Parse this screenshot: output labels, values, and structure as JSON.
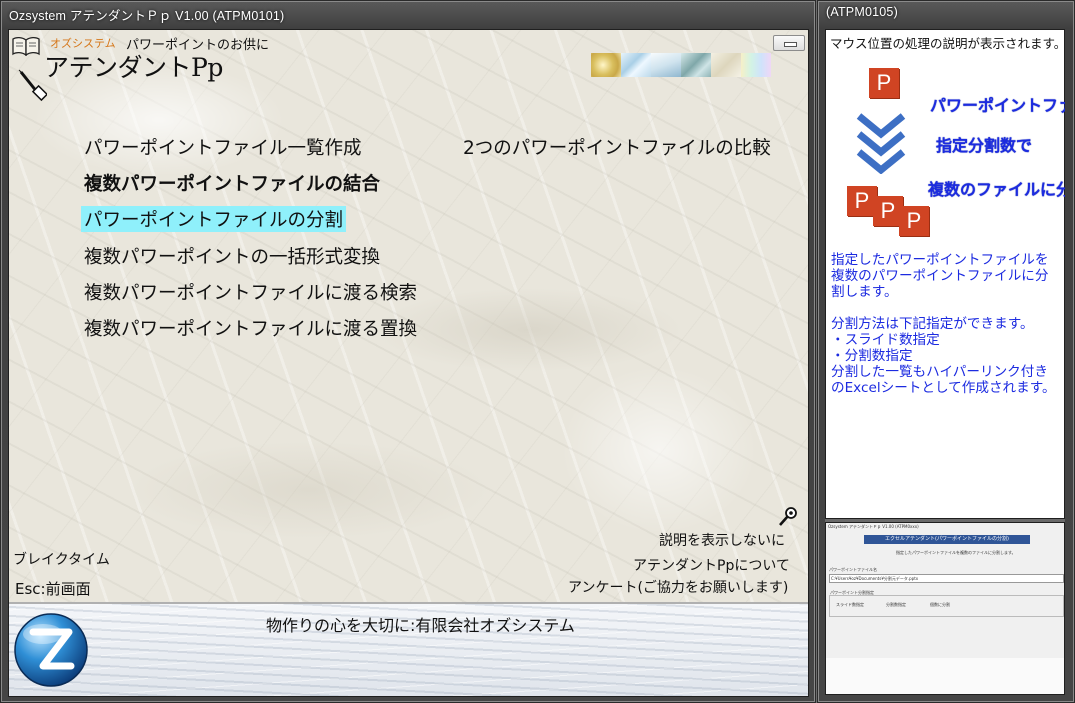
{
  "main_window": {
    "title": "Ozsystem アテンダントＰｐ V1.00 (ATPM0101)",
    "brand_sub": "オズシステム",
    "tagline": "パワーポイントのお供に",
    "app_name": "アテンダントPp",
    "menu": [
      {
        "label": "パワーポイントファイル一覧作成",
        "style": "normal"
      },
      {
        "label": "複数パワーポイントファイルの結合",
        "style": "bold"
      },
      {
        "label": "パワーポイントファイルの分割",
        "style": "selected"
      },
      {
        "label": "複数パワーポイントの一括形式変換",
        "style": "normal"
      },
      {
        "label": "複数パワーポイントファイルに渡る検索",
        "style": "normal"
      },
      {
        "label": "複数パワーポイントファイルに渡る置換",
        "style": "normal"
      },
      {
        "label": "2つのパワーポイントファイルの比較",
        "style": "normal"
      }
    ],
    "break_time": "ブレイクタイム",
    "esc_back": "Esc:前画面",
    "no_explain": "説明を表示しないに",
    "about": "アテンダントPpについて",
    "survey": "アンケート(ご協力をお願いします)",
    "footer_text": "物作りの心を大切に:有限会社オズシステム",
    "colors": {
      "selected_bg": "#8ff0fb",
      "brand_orange": "#d5771a"
    }
  },
  "side_window": {
    "title": "(ATPM0105)",
    "hint": "マウス位置の処理の説明が表示されます。",
    "ppt_letter": "P",
    "heading_lines": [
      "パワーポイントファイルを",
      "指定分割数で",
      "複数のファイルに分割"
    ],
    "description_lines": [
      "指定したパワーポイントファイルを",
      "複数のパワーポイントファイルに分",
      "割します。",
      "",
      "分割方法は下記指定ができます。",
      "・スライド数指定",
      "・分割数指定",
      "分割した一覧もハイパーリンク付き",
      "のExcelシートとして作成されます。"
    ],
    "preview": {
      "window_title": "Ozsystem アテンダントＰｐ V1.00 (ATPM0xxx)",
      "header_bar": "エクセルアテンダント(パワーポイントファイルの分割)",
      "subtitle": "指定したパワーポイントファイルを複数のファイルに分割します。",
      "field_label": "パワーポイントファイル名",
      "path_value": "C:¥Users¥oz¥Documents¥分割元データ.pptx",
      "section_label": "パワーポイント分割指定",
      "option_slide": "スライド数指定",
      "option_split": "分割数指定",
      "split_suffix": "個数に分割"
    },
    "colors": {
      "heading": "#1c2be0",
      "ppt_red": "#d04423"
    }
  }
}
